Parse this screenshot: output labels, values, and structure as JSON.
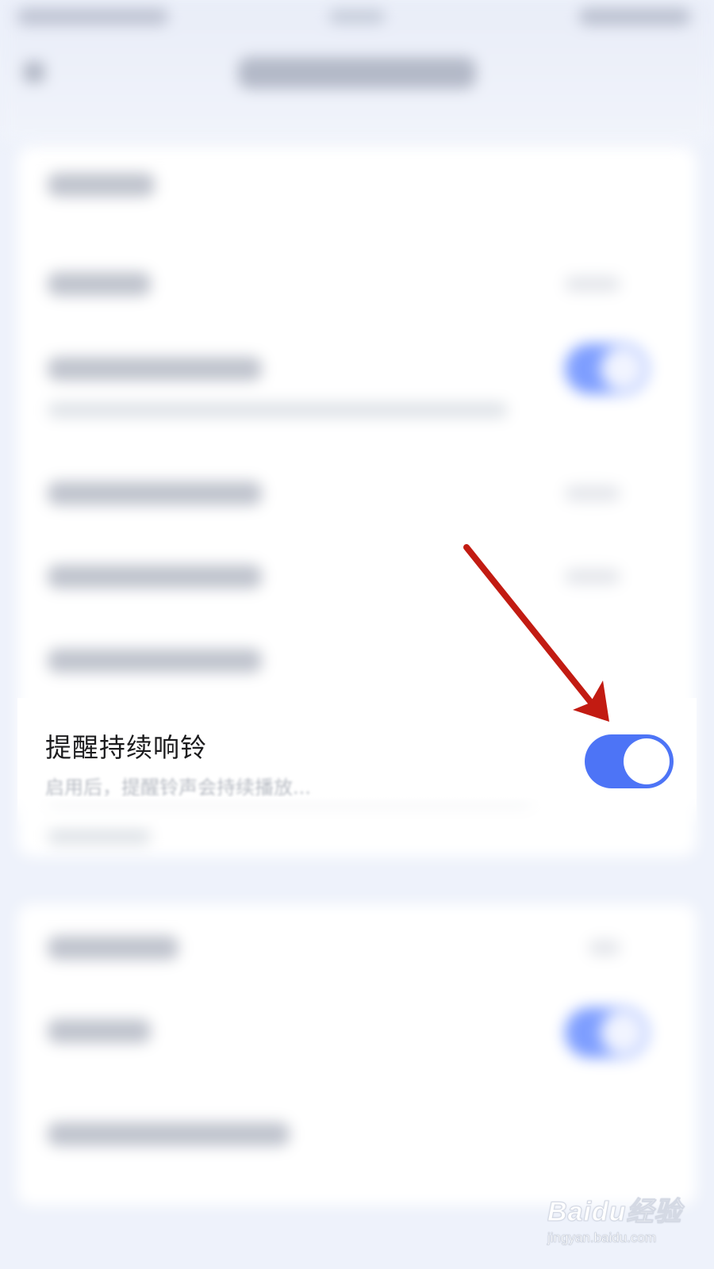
{
  "setting": {
    "label": "提醒持续响铃",
    "description": "启用后，提醒铃声会持续播放...",
    "enabled": true
  },
  "colors": {
    "toggle_on": "#4d74f6",
    "annotation_arrow": "#c21b12",
    "page_background": "#eef2fb"
  },
  "icons": {
    "annotation": "arrow-down-right-icon",
    "toggle": "toggle-switch-icon"
  },
  "watermark": {
    "logo": "Baidu经验",
    "url": "jingyan.baidu.com"
  }
}
